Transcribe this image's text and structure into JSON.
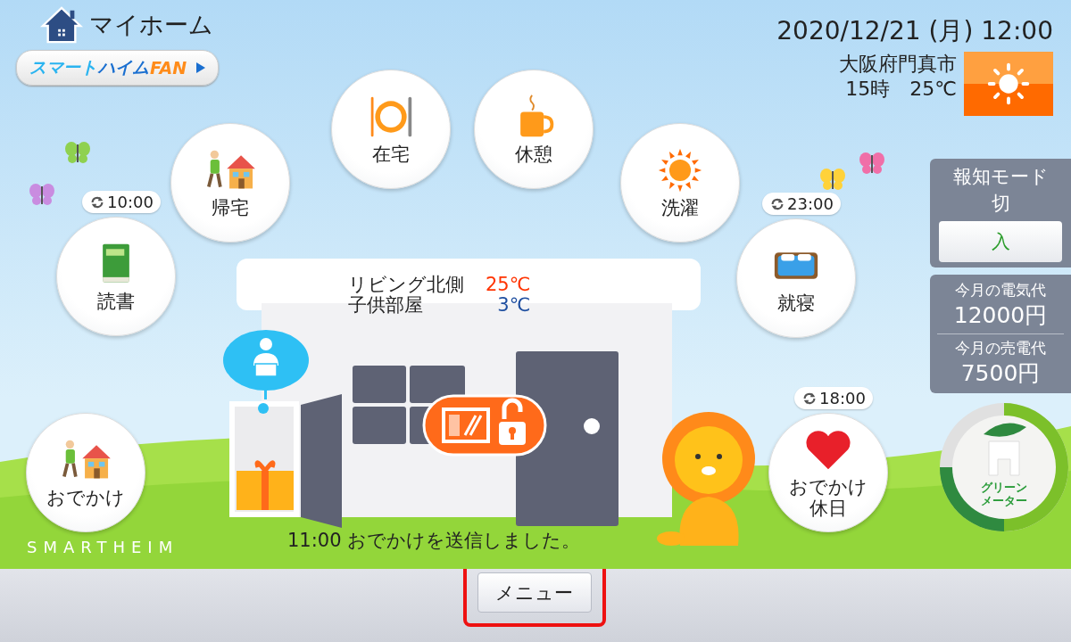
{
  "home": {
    "title": "マイホーム"
  },
  "fan_link": {
    "parts": [
      {
        "text": "スマート",
        "color": "#2ab4f0"
      },
      {
        "text": "ハイム",
        "color": "#1a6fd0"
      },
      {
        "text": "FAN",
        "color": "#ff8c1a"
      }
    ]
  },
  "datetime": "2020/12/21 (月) 12:00",
  "weather": {
    "location": "大阪府門真市",
    "hour": "15時",
    "temperature": "25℃"
  },
  "scenes": [
    {
      "label": "おでかけ",
      "kind": "walk-home"
    },
    {
      "label": "読書",
      "kind": "book",
      "timer": "10:00"
    },
    {
      "label": "帰宅",
      "kind": "walk-home"
    },
    {
      "label": "在宅",
      "kind": "dining"
    },
    {
      "label": "休憩",
      "kind": "coffee"
    },
    {
      "label": "洗濯",
      "kind": "sun"
    },
    {
      "label": "就寝",
      "kind": "bed",
      "timer": "23:00"
    },
    {
      "label": "おでかけ休日",
      "kind": "heart",
      "timer": "18:00"
    }
  ],
  "house": {
    "rooms": [
      {
        "name": "リビング北側",
        "temperature": "25℃",
        "color": "#ff3300"
      },
      {
        "name": "子供部屋",
        "temperature": "3℃",
        "color": "#1f4fa0"
      }
    ],
    "delivery_box": {
      "has_package": true
    },
    "lock": {
      "locked": false
    }
  },
  "status_message": "11:00 おでかけを送信しました。",
  "brand": "SMARTHEIM",
  "notification_mode": {
    "title": "報知モード",
    "state": "切",
    "button": "入"
  },
  "electricity": [
    {
      "label": "今月の電気代",
      "amount": "12000円"
    },
    {
      "label": "今月の売電代",
      "amount": "7500円"
    }
  ],
  "green_meter": {
    "label_lines": [
      "グリーン",
      "メーター"
    ]
  },
  "menu_button": {
    "label": "メニュー",
    "highlighted": true
  }
}
